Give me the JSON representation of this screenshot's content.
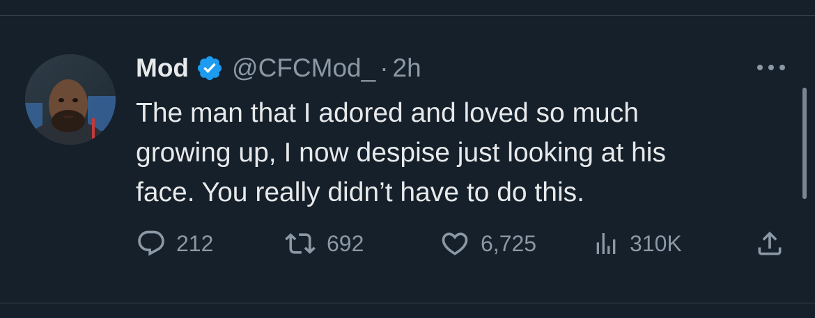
{
  "tweet": {
    "display_name": "Mod",
    "handle": "@CFCMod_",
    "separator": "·",
    "time": "2h",
    "text_lines": [
      "The man that I adored and loved so much",
      "growing up, I now despise just looking at his",
      "face. You really didn’t have to do this."
    ]
  },
  "actions": {
    "replies": "212",
    "reposts": "692",
    "likes": "6,725",
    "views": "310K"
  },
  "icons": {
    "verified": "verified-badge-icon",
    "more": "more-horizontal-icon",
    "reply": "reply-icon",
    "repost": "repost-icon",
    "like": "heart-icon",
    "views": "views-icon",
    "share": "share-icon"
  },
  "colors": {
    "background": "#15202b",
    "text_primary": "#e7e9ea",
    "text_secondary": "#8b98a5",
    "verified_blue": "#1d9bf0",
    "divider": "#38444d"
  }
}
